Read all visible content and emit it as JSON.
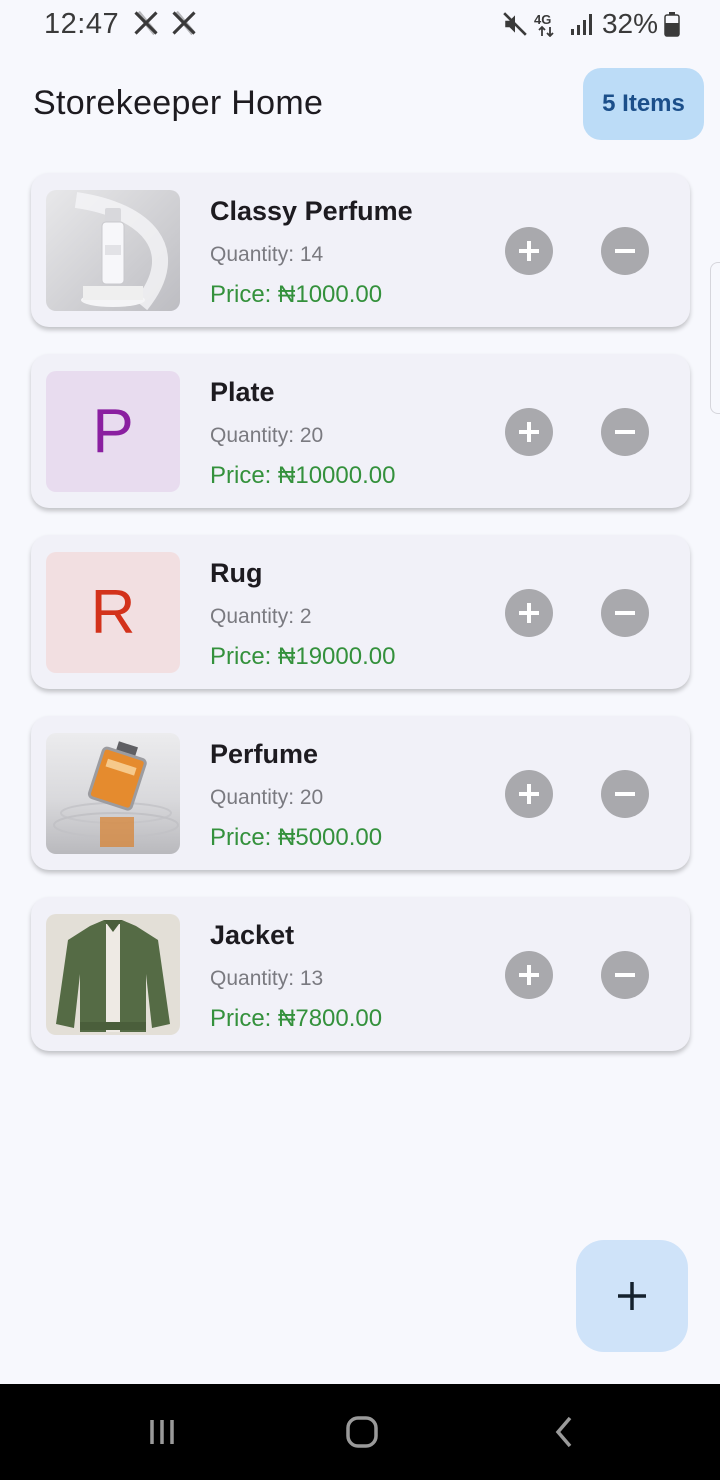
{
  "status_bar": {
    "time": "12:47",
    "battery": "32%",
    "icons": [
      "x-icon",
      "x-icon",
      "mute-icon",
      "lte-icon",
      "signal-icon",
      "battery-icon"
    ]
  },
  "header": {
    "title": "Storekeeper Home",
    "count_chip": "5 Items"
  },
  "colors": {
    "price": "#34913c",
    "chip_bg": "#bcdcf7",
    "fab_bg": "#cfe3f9",
    "plate_letter": "#8a1fa0",
    "rug_letter": "#d3321b"
  },
  "products": [
    {
      "name": "Classy Perfume",
      "quantity": "Quantity: 14",
      "price": "Price: ₦1000.00",
      "thumb": "photo-perfume-bottle-white"
    },
    {
      "name": "Plate",
      "quantity": "Quantity: 20",
      "price": "Price: ₦10000.00",
      "thumb": "letter-avatar",
      "letter": "P"
    },
    {
      "name": "Rug",
      "quantity": "Quantity: 2",
      "price": "Price: ₦19000.00",
      "thumb": "letter-avatar",
      "letter": "R"
    },
    {
      "name": "Perfume",
      "quantity": "Quantity: 20",
      "price": "Price: ₦5000.00",
      "thumb": "photo-perfume-bottle-orange"
    },
    {
      "name": "Jacket",
      "quantity": "Quantity: 13",
      "price": "Price: ₦7800.00",
      "thumb": "photo-green-jacket"
    }
  ],
  "actions": {
    "increment_icon": "plus-circle-icon",
    "decrement_icon": "minus-circle-icon",
    "fab_icon": "add-icon"
  },
  "nav_bar": {
    "buttons": [
      "recents-icon",
      "home-icon",
      "back-icon"
    ]
  }
}
